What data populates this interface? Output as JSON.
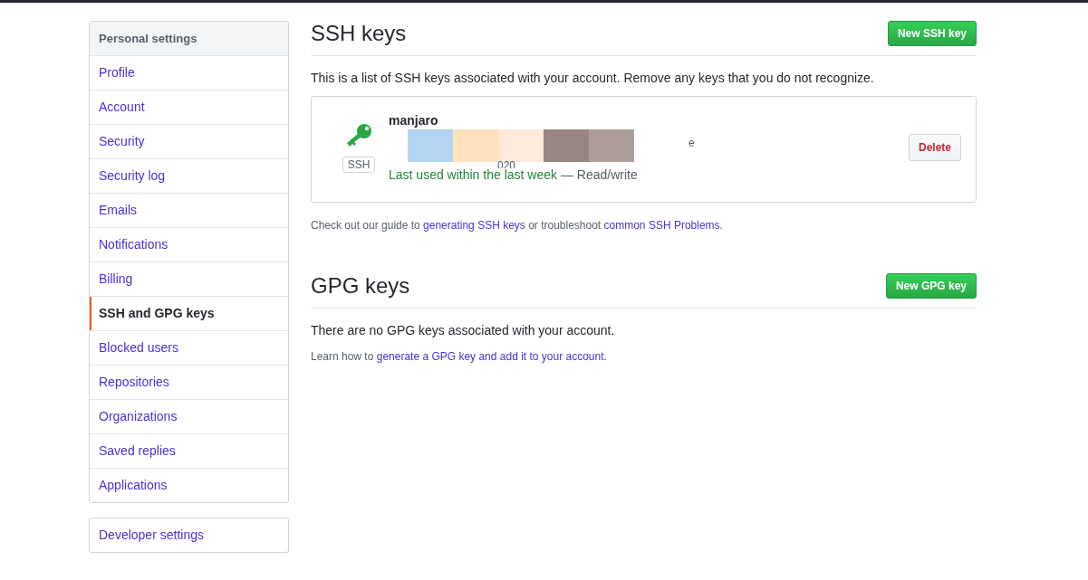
{
  "sidebar": {
    "title": "Personal settings",
    "items": [
      {
        "label": "Profile",
        "selected": false
      },
      {
        "label": "Account",
        "selected": false
      },
      {
        "label": "Security",
        "selected": false
      },
      {
        "label": "Security log",
        "selected": false
      },
      {
        "label": "Emails",
        "selected": false
      },
      {
        "label": "Notifications",
        "selected": false
      },
      {
        "label": "Billing",
        "selected": false
      },
      {
        "label": "SSH and GPG keys",
        "selected": true
      },
      {
        "label": "Blocked users",
        "selected": false
      },
      {
        "label": "Repositories",
        "selected": false
      },
      {
        "label": "Organizations",
        "selected": false
      },
      {
        "label": "Saved replies",
        "selected": false
      },
      {
        "label": "Applications",
        "selected": false
      }
    ],
    "extra": "Developer settings"
  },
  "ssh": {
    "title": "SSH keys",
    "button": "New SSH key",
    "intro": "This is a list of SSH keys associated with your account. Remove any keys that you do not recognize.",
    "keys": [
      {
        "badge": "SSH",
        "name": "manjaro",
        "fingerprint_tail": "e",
        "date_fragment": "020",
        "usage": "Last used within the last week",
        "access": "— Read/write",
        "delete": "Delete"
      }
    ],
    "help": [
      {
        "kind": "text",
        "text": "Check out our guide to "
      },
      {
        "kind": "link",
        "text": "generating SSH keys"
      },
      {
        "kind": "text",
        "text": " or troubleshoot "
      },
      {
        "kind": "link",
        "text": "common SSH Problems"
      },
      {
        "kind": "text",
        "text": "."
      }
    ]
  },
  "gpg": {
    "title": "GPG keys",
    "button": "New GPG key",
    "empty": "There are no GPG keys associated with your account.",
    "help": [
      {
        "kind": "text",
        "text": "Learn how to "
      },
      {
        "kind": "link",
        "text": "generate a GPG key and add it to your account"
      },
      {
        "kind": "text",
        "text": "."
      }
    ]
  }
}
